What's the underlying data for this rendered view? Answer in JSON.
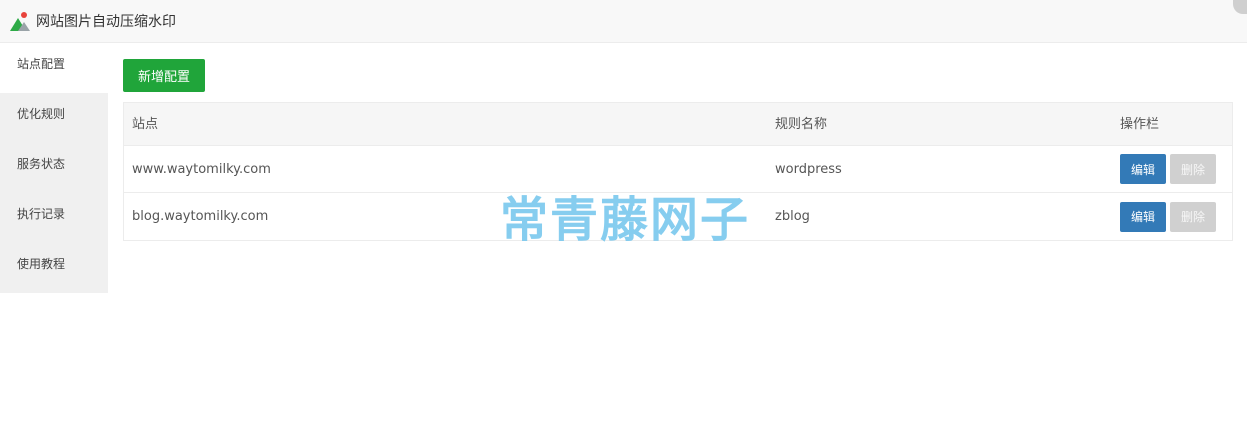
{
  "window": {
    "title": "网站图片自动压缩水印"
  },
  "sidebar": {
    "items": [
      {
        "label": "站点配置",
        "active": true
      },
      {
        "label": "优化规则",
        "active": false
      },
      {
        "label": "服务状态",
        "active": false
      },
      {
        "label": "执行记录",
        "active": false
      },
      {
        "label": "使用教程",
        "active": false
      }
    ]
  },
  "toolbar": {
    "add_label": "新增配置"
  },
  "table": {
    "headers": {
      "site": "站点",
      "rule": "规则名称",
      "ops": "操作栏"
    },
    "rows": [
      {
        "site": "www.waytomilky.com",
        "rule": "wordpress",
        "edit": "编辑",
        "delete": "删除"
      },
      {
        "site": "blog.waytomilky.com",
        "rule": "zblog",
        "edit": "编辑",
        "delete": "删除"
      }
    ]
  },
  "watermark": {
    "text": "常青藤网子"
  },
  "colors": {
    "accent": "#20a53a",
    "edit": "#337ab7",
    "disabled": "#d0d0d0",
    "watermark": "#79c8ee"
  }
}
